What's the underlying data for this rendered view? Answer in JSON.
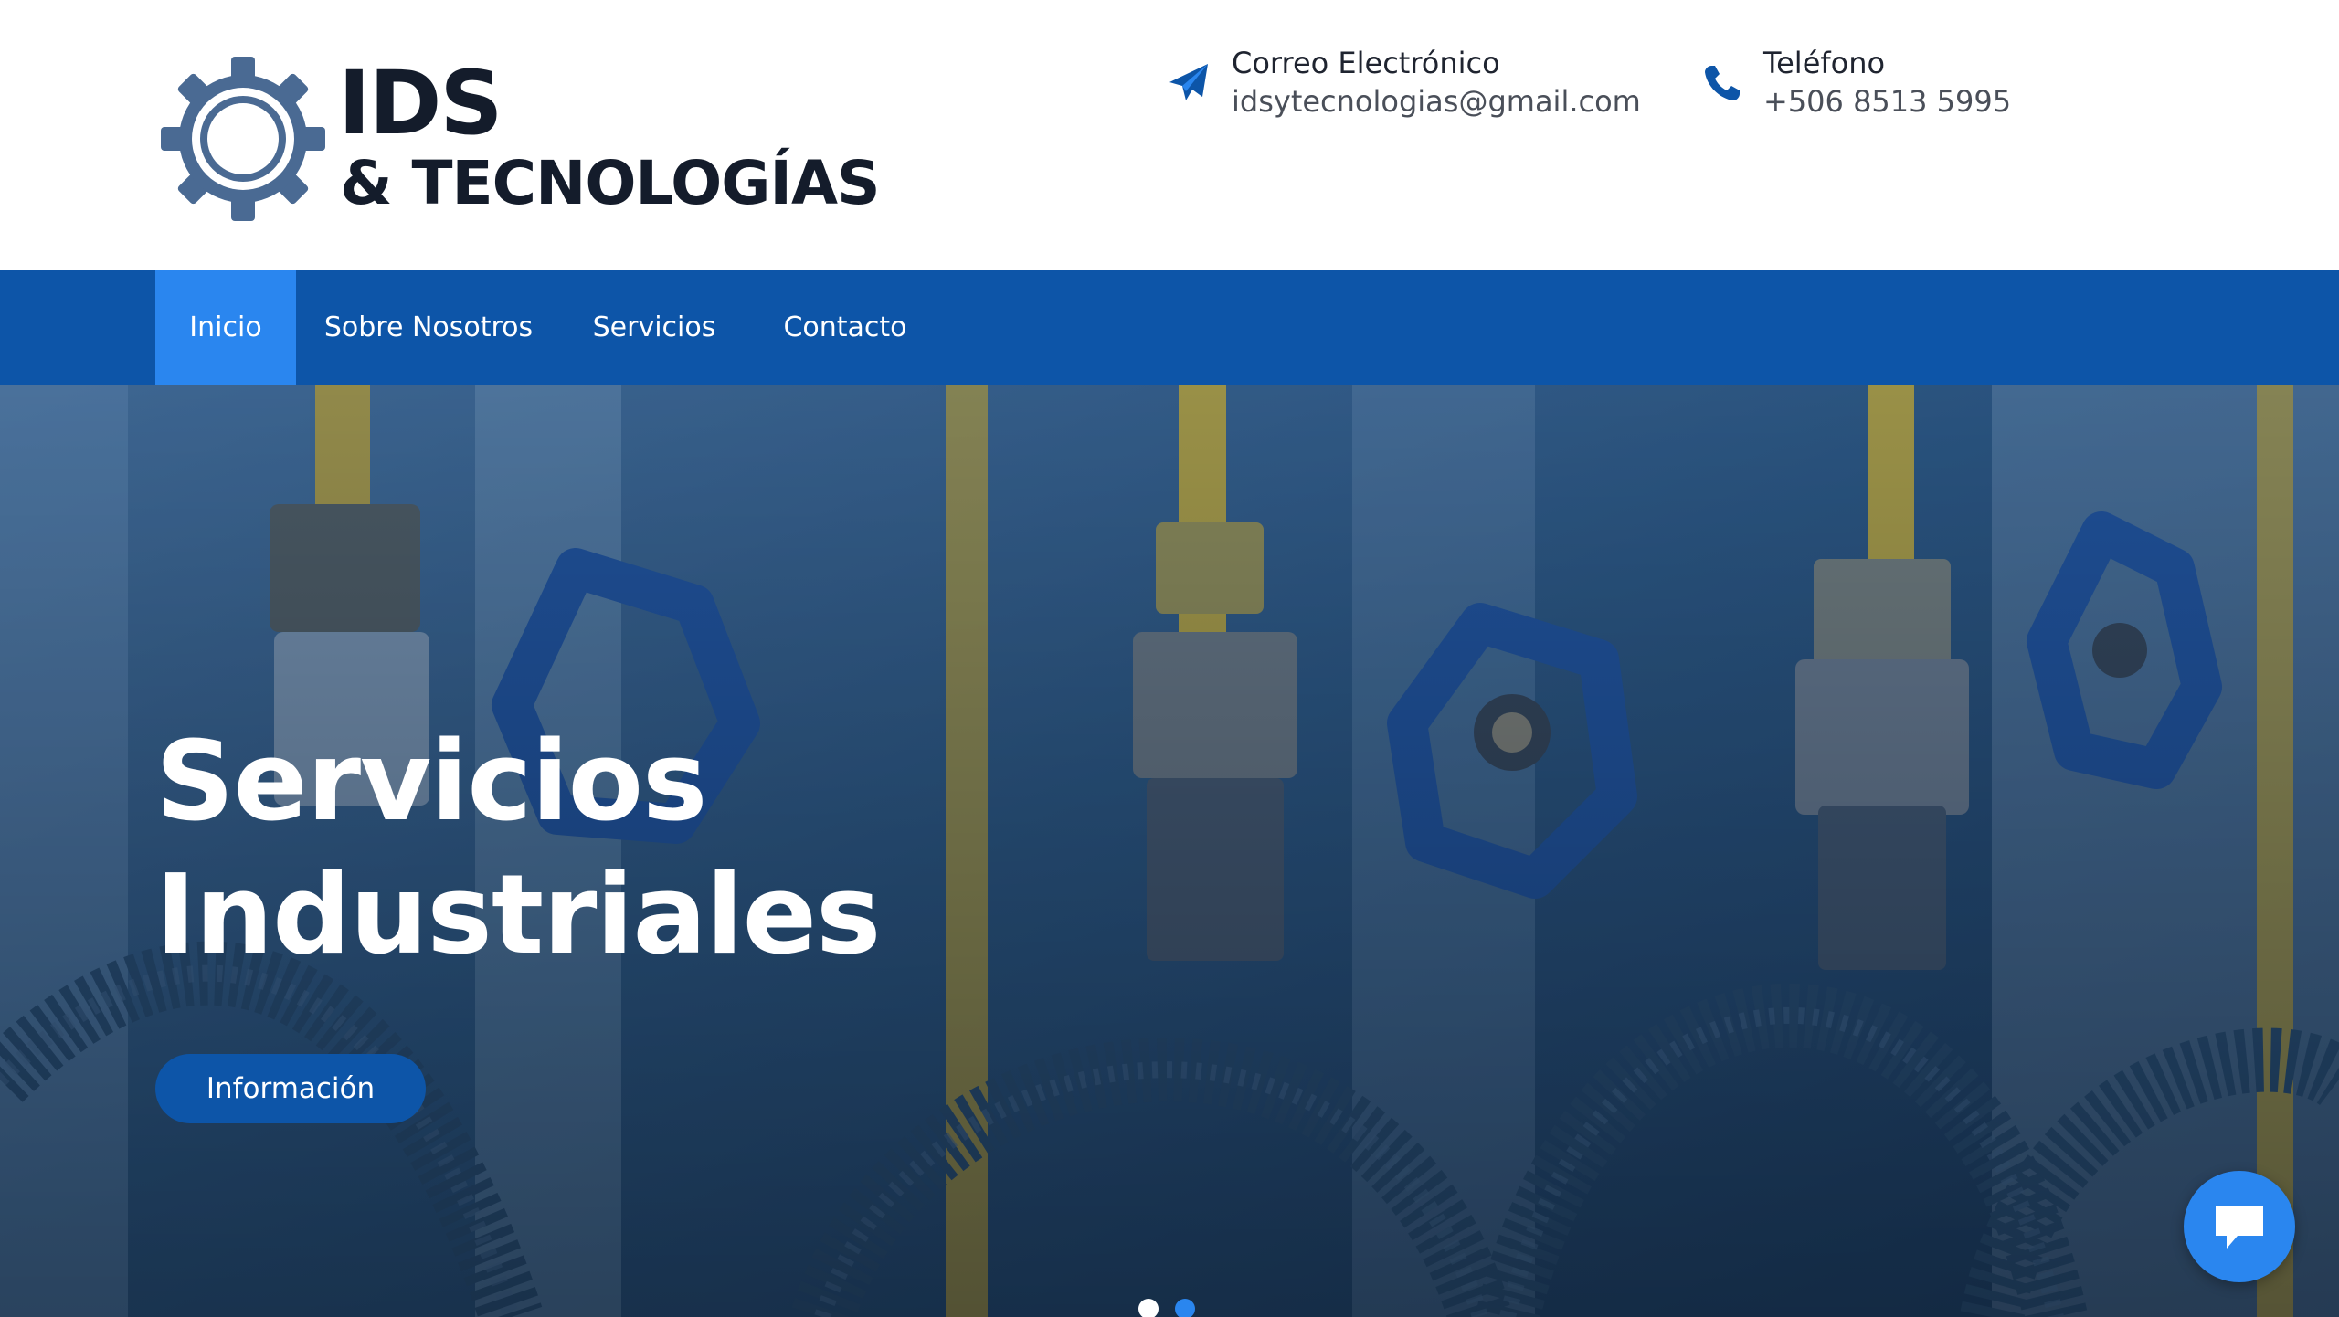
{
  "brand": {
    "name_line1": "IDS",
    "name_line2": "& TECNOLOGÍAS",
    "logo_icon": "gear-icon",
    "logo_color": "#4a6a93"
  },
  "contact": {
    "email": {
      "icon": "paper-plane-icon",
      "label": "Correo Electrónico",
      "value": "idsytecnologias@gmail.com"
    },
    "phone": {
      "icon": "phone-icon",
      "label": "Teléfono",
      "value": "+506 8513 5995"
    }
  },
  "nav": {
    "items": [
      {
        "label": "Inicio",
        "active": true
      },
      {
        "label": "Sobre Nosotros",
        "active": false
      },
      {
        "label": "Servicios",
        "active": false
      },
      {
        "label": "Contacto",
        "active": false
      }
    ]
  },
  "hero": {
    "title_line1": "Servicios",
    "title_line2": "Industriales",
    "button_label": "Información",
    "background": "industrial valves and pipes photo, blue tint",
    "slides": {
      "count": 2,
      "active_index": 0
    }
  },
  "chat": {
    "icon": "chat-bubble-icon"
  },
  "colors": {
    "primary": "#0d55a8",
    "accent": "#2a86ef",
    "text_dark": "#141c2b",
    "text_muted": "#4a4f59",
    "white": "#ffffff"
  }
}
